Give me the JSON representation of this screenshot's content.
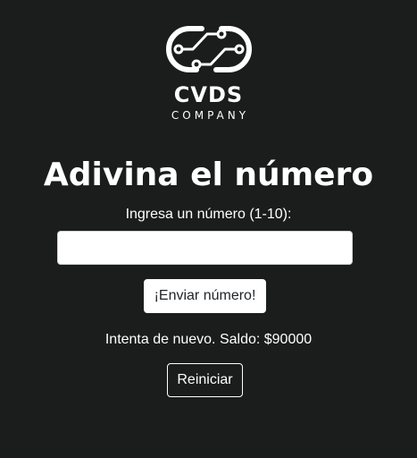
{
  "logo": {
    "icon": "circuit-link-logo-icon",
    "name": "CVDS",
    "subtitle": "COMPANY"
  },
  "game": {
    "title": "Adivina el número",
    "prompt": "Ingresa un número (1-10):",
    "input": {
      "value": "",
      "placeholder": ""
    },
    "submit_label": "¡Enviar número!",
    "status": "Intenta de nuevo. Saldo: $90000",
    "reset_label": "Reiniciar"
  },
  "colors": {
    "background": "#1b1c1c",
    "text": "#ffffff",
    "input_bg": "#ffffff",
    "submit_bg": "#ffffff",
    "submit_text": "#212529"
  }
}
